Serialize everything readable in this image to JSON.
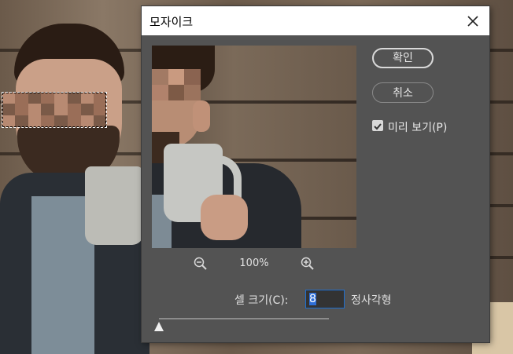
{
  "dialog": {
    "title": "모자이크",
    "ok_label": "확인",
    "cancel_label": "취소",
    "preview_label": "미리 보기(P)",
    "preview_checked": true,
    "zoom_value": "100%",
    "cell_size_label": "셀 크기(C):",
    "cell_size_value": "8",
    "cell_size_unit": "정사각형",
    "slider_level": 0.0
  },
  "icons": {
    "close": "close-icon",
    "zoom_out": "zoom-out-icon",
    "zoom_in": "zoom-in-icon",
    "check": "checkmark-icon"
  }
}
